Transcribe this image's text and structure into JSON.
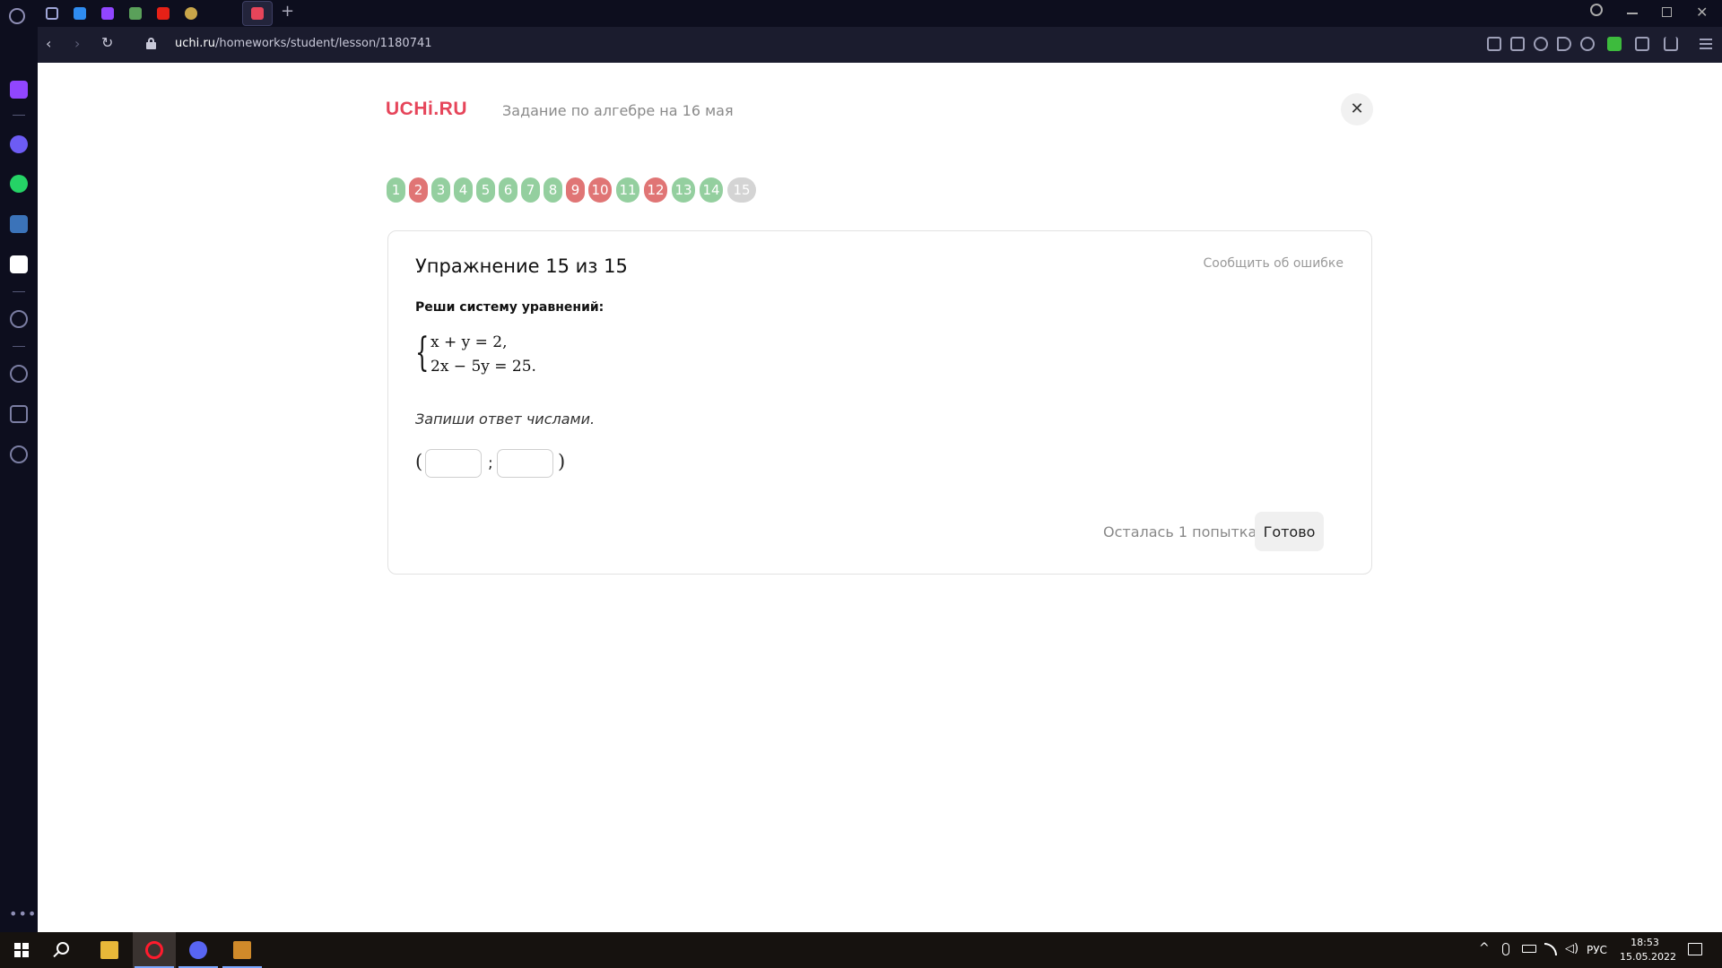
{
  "browser": {
    "url_host": "uchi.ru",
    "url_path": "/homeworks/student/lesson/1180741",
    "new_tab_label": "+"
  },
  "page": {
    "logo": "UCHi.RU",
    "lesson_title": "Задание по алгебре на 16 мая",
    "close_label": "✕",
    "steps": [
      {
        "label": "1",
        "status": "correct"
      },
      {
        "label": "2",
        "status": "wrong"
      },
      {
        "label": "3",
        "status": "correct"
      },
      {
        "label": "4",
        "status": "correct"
      },
      {
        "label": "5",
        "status": "correct"
      },
      {
        "label": "6",
        "status": "correct"
      },
      {
        "label": "7",
        "status": "correct"
      },
      {
        "label": "8",
        "status": "correct"
      },
      {
        "label": "9",
        "status": "wrong"
      },
      {
        "label": "10",
        "status": "wrong"
      },
      {
        "label": "11",
        "status": "correct"
      },
      {
        "label": "12",
        "status": "wrong"
      },
      {
        "label": "13",
        "status": "correct"
      },
      {
        "label": "14",
        "status": "correct"
      },
      {
        "label": "15",
        "status": "current"
      }
    ],
    "exercise": {
      "title": "Упражнение 15 из 15",
      "report_link": "Сообщить об ошибке",
      "prompt": "Реши систему уравнений:",
      "equation_1": "x + y = 2,",
      "equation_2": "2x − 5y = 25.",
      "instruction": "Запиши ответ числами.",
      "answer_open": "(",
      "answer_separator": ";",
      "answer_close": ")",
      "answer_x_value": "",
      "answer_y_value": "",
      "attempts_left": "Осталась 1 попытка",
      "submit_label": "Готово"
    }
  },
  "taskbar": {
    "language": "РУС",
    "time": "18:53",
    "date": "15.05.2022"
  },
  "colors": {
    "logo": "#e6455a",
    "step_correct": "#94cf9f",
    "step_wrong": "#e07575",
    "step_current": "#d4d4d4"
  }
}
